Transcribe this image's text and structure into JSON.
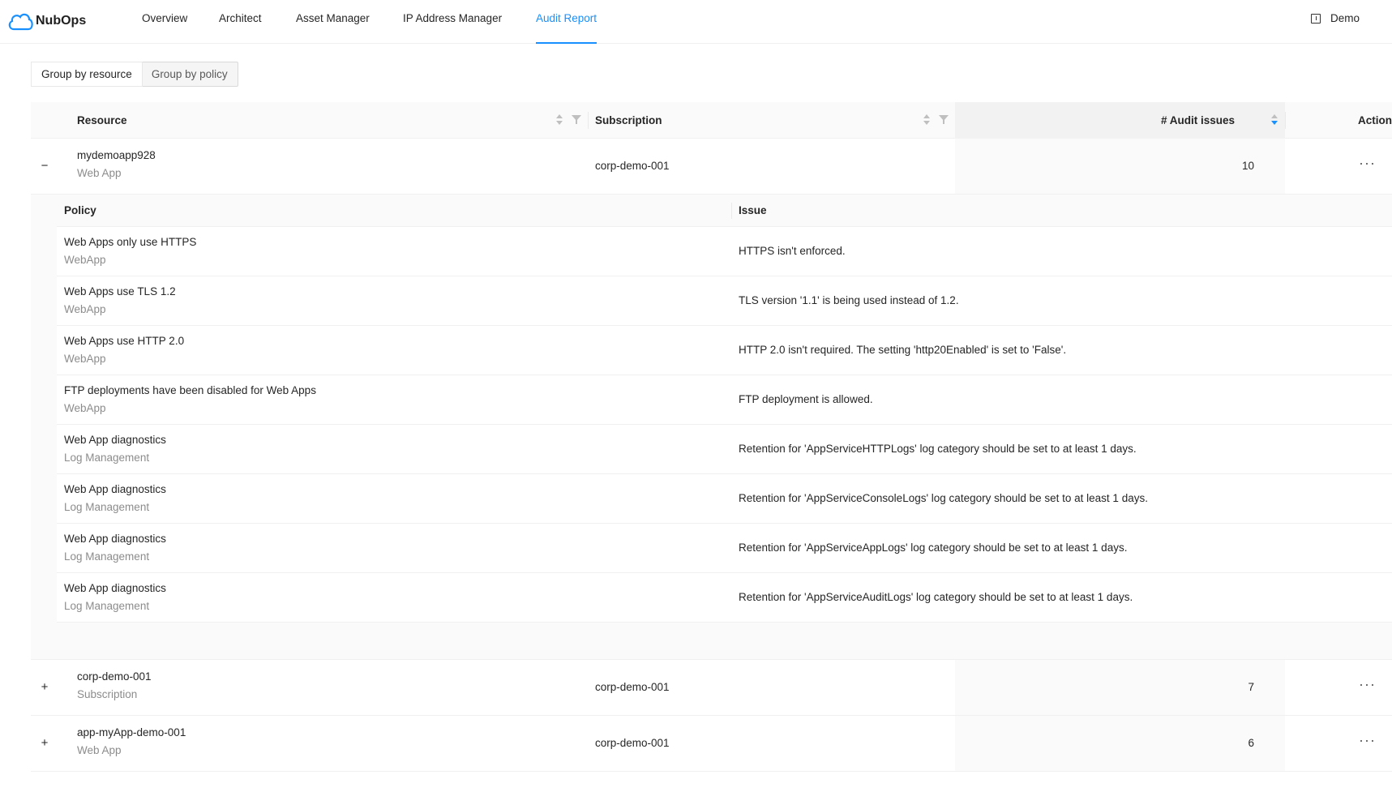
{
  "app": {
    "brand": "NubOps",
    "nav": [
      "Overview",
      "Architect",
      "Asset Manager",
      "IP Address Manager",
      "Audit Report"
    ],
    "active_nav": "Audit Report",
    "user": "Demo",
    "accent": "#1890ff"
  },
  "segments": {
    "group_by_resource": "Group by resource",
    "group_by_policy": "Group by policy",
    "selected": "Group by resource"
  },
  "table": {
    "headers": {
      "resource": "Resource",
      "subscription": "Subscription",
      "audit_issues": "# Audit issues",
      "action": "Action"
    },
    "rows": [
      {
        "name": "mydemoapp928",
        "type": "Web App",
        "subscription": "corp-demo-001",
        "issues": "10",
        "expanded": true
      },
      {
        "name": "corp-demo-001",
        "type": "Subscription",
        "subscription": "corp-demo-001",
        "issues": "7",
        "expanded": false
      },
      {
        "name": "app-myApp-demo-001",
        "type": "Web App",
        "subscription": "corp-demo-001",
        "issues": "6",
        "expanded": false
      }
    ],
    "expand_symbol_open": "−",
    "expand_symbol_closed": "+",
    "more_symbol": "···"
  },
  "nested": {
    "headers": {
      "policy": "Policy",
      "issue": "Issue"
    },
    "rows": [
      {
        "policy": "Web Apps only use HTTPS",
        "category": "WebApp",
        "issue": "HTTPS isn't enforced."
      },
      {
        "policy": "Web Apps use TLS 1.2",
        "category": "WebApp",
        "issue": "TLS version '1.1' is being used instead of 1.2."
      },
      {
        "policy": "Web Apps use HTTP 2.0",
        "category": "WebApp",
        "issue": "HTTP 2.0 isn't required. The setting 'http20Enabled' is set to 'False'."
      },
      {
        "policy": "FTP deployments have been disabled for Web Apps",
        "category": "WebApp",
        "issue": "FTP deployment is allowed."
      },
      {
        "policy": "Web App diagnostics",
        "category": "Log Management",
        "issue": "Retention for 'AppServiceHTTPLogs' log category should be set to at least 1 days."
      },
      {
        "policy": "Web App diagnostics",
        "category": "Log Management",
        "issue": "Retention for 'AppServiceConsoleLogs' log category should be set to at least 1 days."
      },
      {
        "policy": "Web App diagnostics",
        "category": "Log Management",
        "issue": "Retention for 'AppServiceAppLogs' log category should be set to at least 1 days."
      },
      {
        "policy": "Web App diagnostics",
        "category": "Log Management",
        "issue": "Retention for 'AppServiceAuditLogs' log category should be set to at least 1 days."
      }
    ]
  }
}
